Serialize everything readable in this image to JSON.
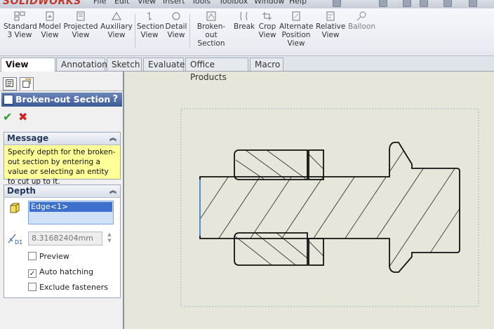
{
  "app": {
    "logo_text": "SOLIDWORKS"
  },
  "menu": [
    "File",
    "Edit",
    "View",
    "Insert",
    "Tools",
    "Toolbox",
    "Window",
    "Help"
  ],
  "toolbar": {
    "items": [
      {
        "id": "standard3",
        "label1": "Standard",
        "label2": "3 View",
        "icon": "standard-3-view-icon"
      },
      {
        "id": "model",
        "label1": "Model",
        "label2": "View",
        "icon": "model-view-icon"
      },
      {
        "id": "projected",
        "label1": "Projected",
        "label2": "View",
        "icon": "projected-view-icon"
      },
      {
        "id": "auxiliary",
        "label1": "Auxiliary",
        "label2": "View",
        "icon": "auxiliary-view-icon"
      },
      {
        "id": "section",
        "label1": "Section",
        "label2": "View",
        "icon": "section-view-icon"
      },
      {
        "id": "detail",
        "label1": "Detail",
        "label2": "View",
        "icon": "detail-view-icon"
      },
      {
        "id": "brokenout",
        "label1": "Broken-out",
        "label2": "Section",
        "icon": "broken-out-section-icon"
      },
      {
        "id": "break",
        "label1": "Break",
        "label2": "",
        "icon": "break-icon"
      },
      {
        "id": "crop",
        "label1": "Crop",
        "label2": "View",
        "icon": "crop-view-icon"
      },
      {
        "id": "alternate",
        "label1": "Alternate",
        "label2": "Position",
        "label3": "View",
        "icon": "alternate-position-view-icon"
      },
      {
        "id": "relative",
        "label1": "Relative",
        "label2": "View",
        "icon": "relative-view-icon"
      },
      {
        "id": "balloon",
        "label1": "Balloon",
        "label2": "",
        "icon": "balloon-icon"
      }
    ]
  },
  "tabs": [
    {
      "label": "View Layout",
      "active": true
    },
    {
      "label": "Annotation",
      "active": false
    },
    {
      "label": "Sketch",
      "active": false
    },
    {
      "label": "Evaluate",
      "active": false
    },
    {
      "label": "Office Products",
      "active": false
    },
    {
      "label": "Macro",
      "active": false
    }
  ],
  "property_manager": {
    "title": "Broken-out Section",
    "help": "?",
    "message": {
      "header": "Message",
      "text": "Specify depth for the broken-out section by entering a value or selecting an entity to cut up to it."
    },
    "depth": {
      "header": "Depth",
      "selection": "Edge<1>",
      "value": "8.31682404mm",
      "value_icon_label": "D1"
    },
    "options": [
      {
        "label": "Preview",
        "checked": false
      },
      {
        "label": "Auto hatching",
        "checked": true
      },
      {
        "label": "Exclude fasteners",
        "checked": false
      }
    ]
  },
  "colors": {
    "title_bar": "#3c5a96",
    "message_bg": "#ffff99",
    "selection_bg": "#3d6fcc",
    "sheet_bg": "#e7e6da",
    "ok_green": "#2a9a2a",
    "cancel_red": "#cc2222"
  }
}
